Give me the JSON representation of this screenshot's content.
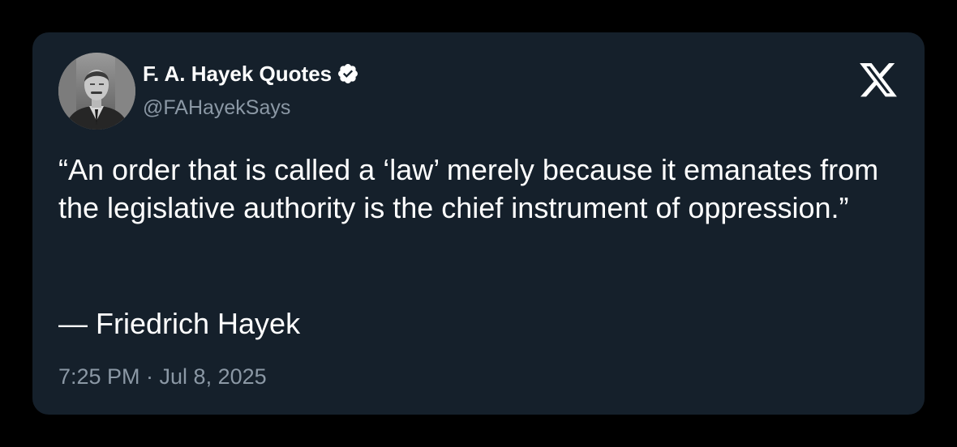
{
  "tweet": {
    "author": {
      "display_name": "F. A. Hayek Quotes",
      "handle": "@FAHayekSays",
      "verified": true,
      "avatar_icon": "portrait-photo"
    },
    "platform_icon": "x-logo-icon",
    "text": "“An order that is called a ‘law’ merely because it emanates from the legislative authority is the chief instrument of oppression.”",
    "attribution": "— Friedrich Hayek",
    "timestamp": "7:25 PM · Jul 8, 2025"
  },
  "colors": {
    "background": "#000000",
    "card": "#15202b",
    "text": "#ffffff",
    "secondary_text": "#8b98a5",
    "verified_badge": "#ffffff"
  }
}
